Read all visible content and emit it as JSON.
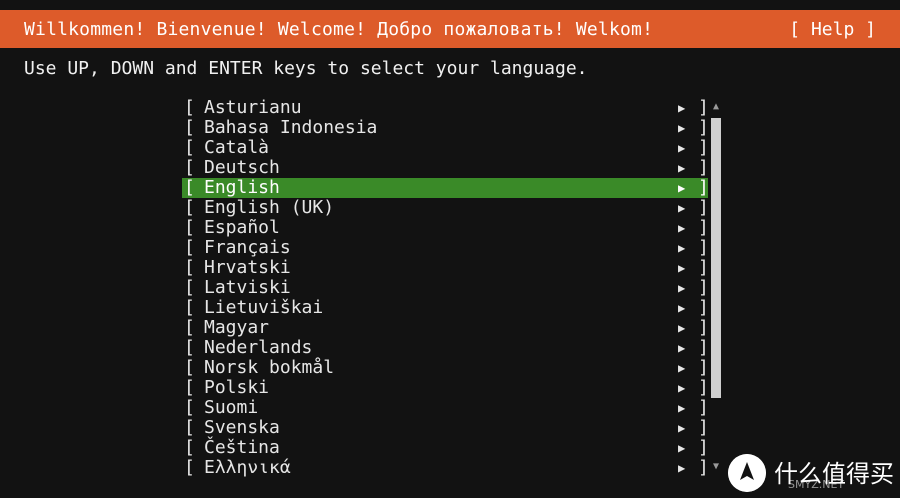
{
  "header": {
    "title": "Willkommen! Bienvenue! Welcome! Добро пожаловать! Welkom!",
    "help_label": "[ Help ]"
  },
  "instructions": "Use UP, DOWN and ENTER keys to select your language.",
  "languages": [
    "Asturianu",
    "Bahasa Indonesia",
    "Català",
    "Deutsch",
    "English",
    "English (UK)",
    "Español",
    "Français",
    "Hrvatski",
    "Latviski",
    "Lietuviškai",
    "Magyar",
    "Nederlands",
    "Norsk bokmål",
    "Polski",
    "Suomi",
    "Svenska",
    "Čeština",
    "Ελληνικά"
  ],
  "selected_language": "English",
  "item_glyphs": {
    "open": "[",
    "arrow": "▶",
    "close": "]"
  },
  "scroll_glyphs": {
    "up": "▲",
    "down": "▼"
  },
  "watermark": {
    "text": "什么值得买",
    "sub": "SMYZ.NET"
  },
  "colors": {
    "header_bg": "#dd5b2a",
    "selection_bg": "#3a8a28",
    "background": "#121212"
  },
  "icons": {
    "item_arrow": "play-triangle-icon",
    "scroll_up": "triangle-up-icon",
    "scroll_down": "triangle-down-icon",
    "watermark_logo": "smzdm-logo-icon"
  }
}
